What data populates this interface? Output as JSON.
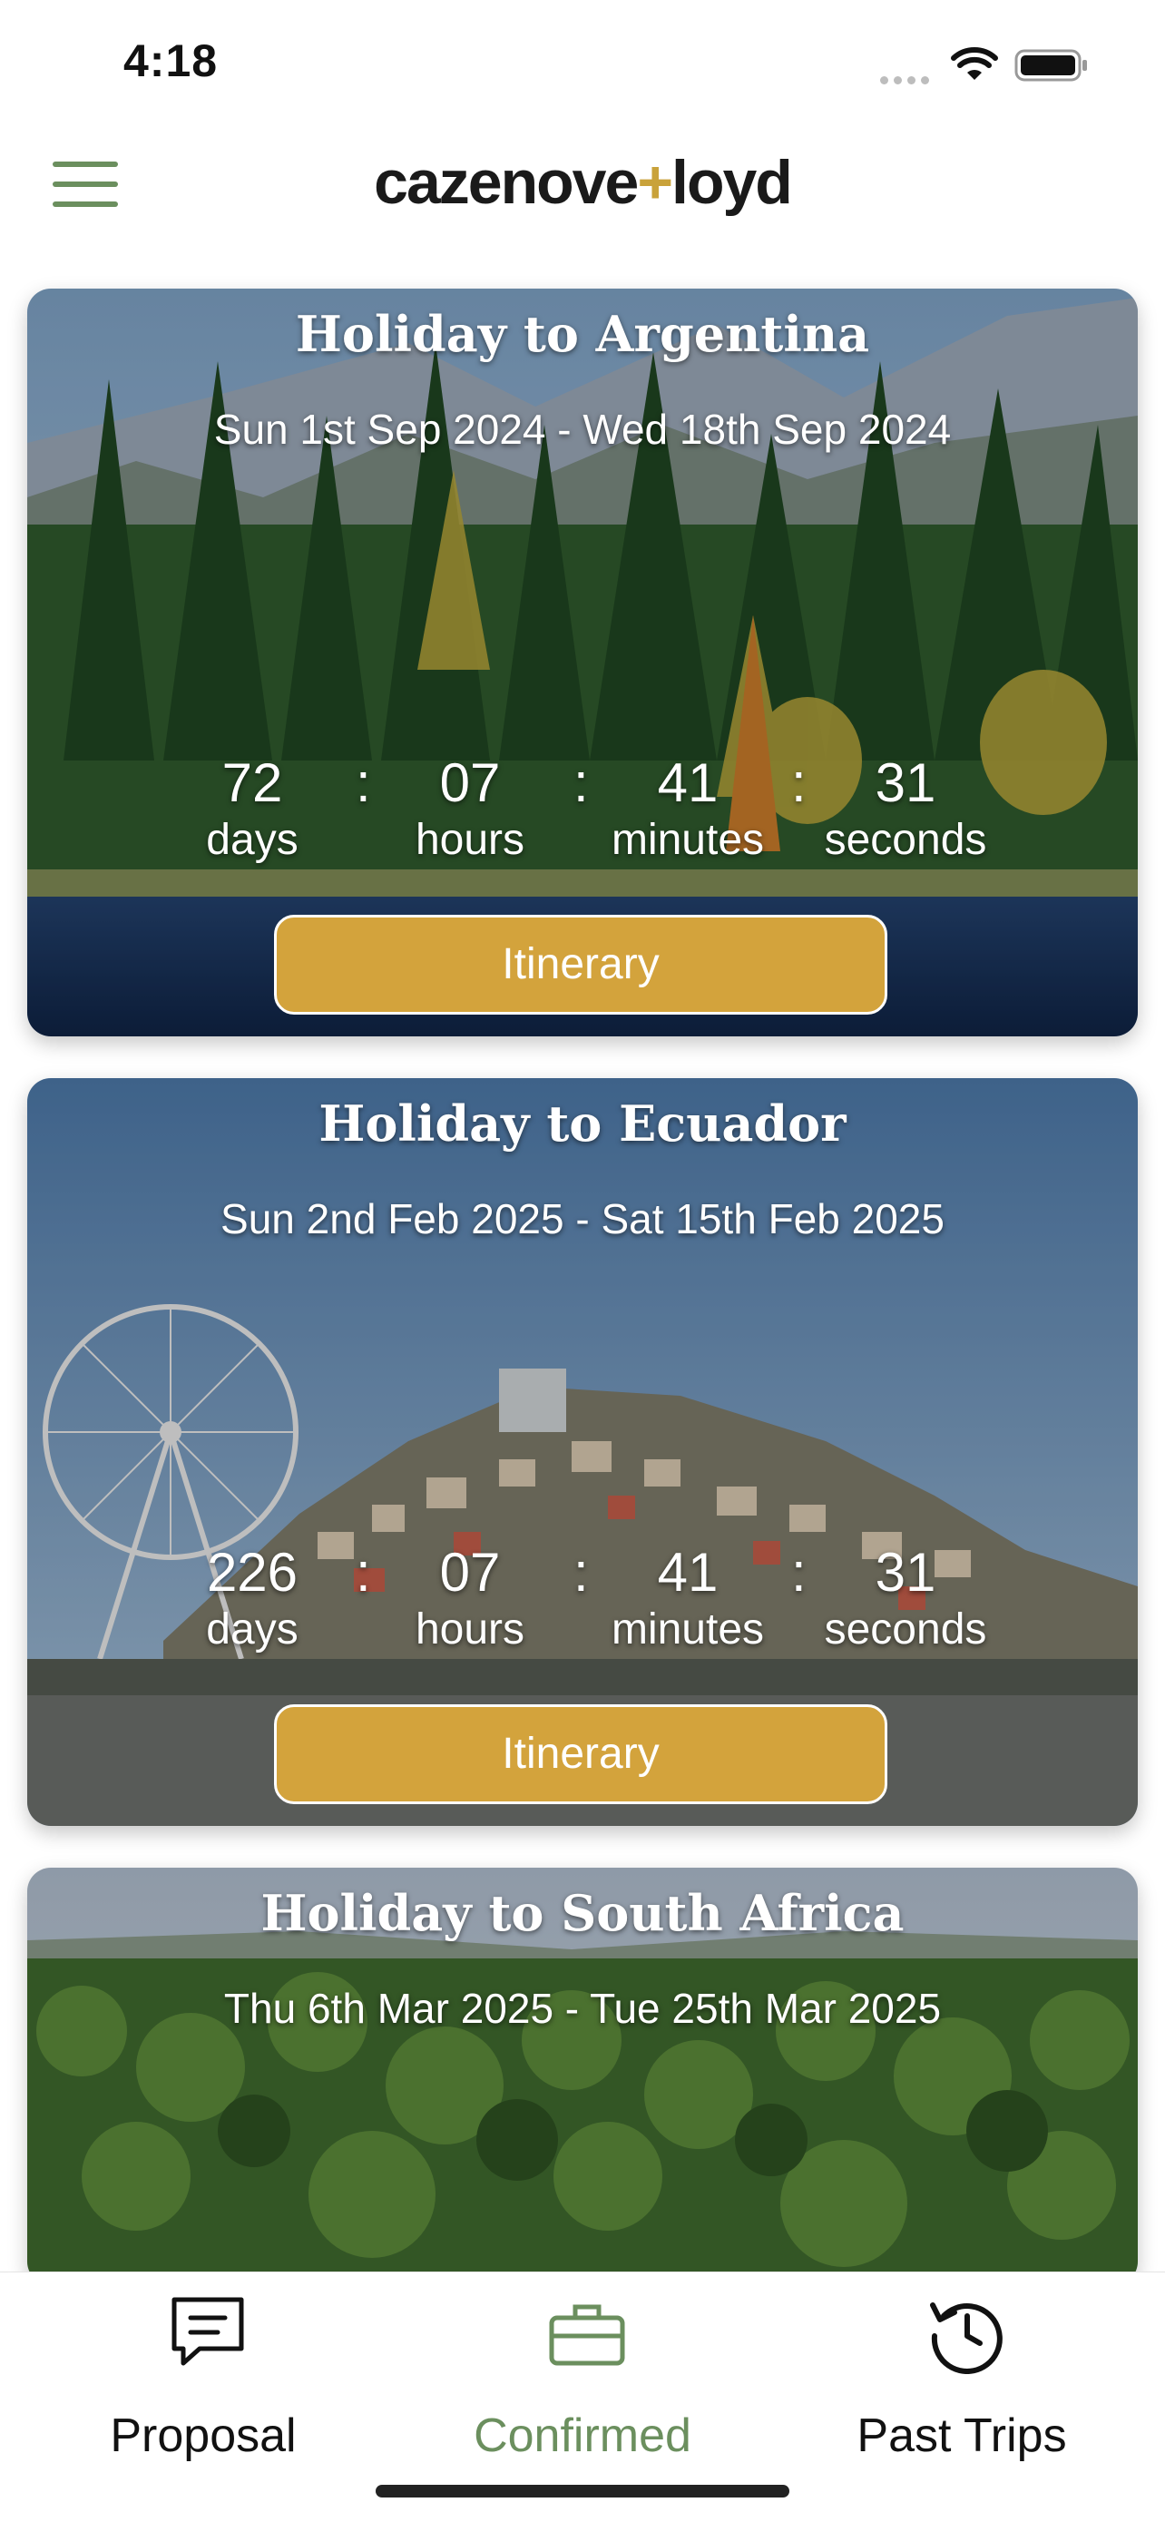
{
  "status_bar": {
    "time": "4:18"
  },
  "header": {
    "logo_left": "cazenove",
    "logo_plus": "+",
    "logo_right": "loyd"
  },
  "trips": [
    {
      "title": "Holiday to Argentina",
      "dates": "Sun 1st Sep 2024 - Wed 18th Sep 2024",
      "countdown": {
        "days": "72",
        "hours": "07",
        "minutes": "41",
        "seconds": "31"
      },
      "button": "Itinerary"
    },
    {
      "title": "Holiday to Ecuador",
      "dates": "Sun 2nd Feb 2025 - Sat 15th Feb 2025",
      "countdown": {
        "days": "226",
        "hours": "07",
        "minutes": "41",
        "seconds": "31"
      },
      "button": "Itinerary"
    },
    {
      "title": "Holiday to South Africa",
      "dates": "Thu 6th Mar 2025 - Tue 25th Mar 2025"
    }
  ],
  "countdown_labels": {
    "days": "days",
    "hours": "hours",
    "minutes": "minutes",
    "seconds": "seconds",
    "separator": ":"
  },
  "tabs": [
    {
      "label": "Proposal",
      "icon": "message-icon",
      "active": false
    },
    {
      "label": "Confirmed",
      "icon": "briefcase-icon",
      "active": true
    },
    {
      "label": "Past Trips",
      "icon": "history-icon",
      "active": false
    }
  ],
  "colors": {
    "accent": "#d3a33c",
    "green": "#6b8f5e"
  }
}
